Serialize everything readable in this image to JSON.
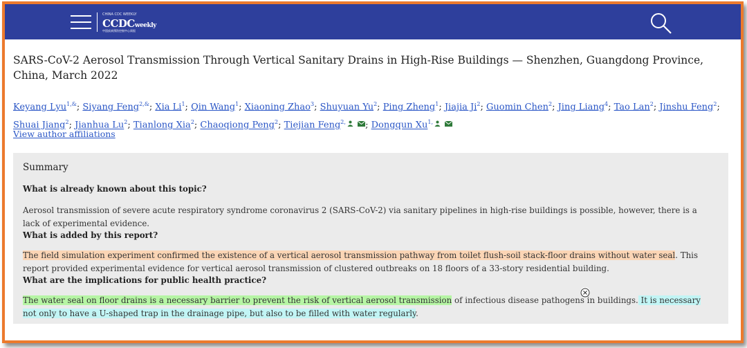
{
  "header": {
    "logo_top": "CHINA CDC WEEKLY",
    "logo_main": "CCDC",
    "logo_suffix": "weekly",
    "logo_sub": "中国疾病预防控制中心周报",
    "bg_color": "#2e3f9c"
  },
  "article": {
    "title": "SARS-CoV-2 Aerosol Transmission Through Vertical Sanitary Drains in High-Rise Buildings — Shenzhen, Guangdong Province, China, March 2022",
    "authors": [
      {
        "name": "Keyang Lyu",
        "sup": "1,&"
      },
      {
        "name": "Siyang Feng",
        "sup": "2,&"
      },
      {
        "name": "Xia Li",
        "sup": "1"
      },
      {
        "name": "Qin Wang",
        "sup": "1"
      },
      {
        "name": "Xiaoning Zhao",
        "sup": "3"
      },
      {
        "name": "Shuyuan Yu",
        "sup": "2"
      },
      {
        "name": "Ping Zheng",
        "sup": "1"
      },
      {
        "name": "Jiajia Ji",
        "sup": "2"
      },
      {
        "name": "Guomin Chen",
        "sup": "2"
      },
      {
        "name": "Jing Liang",
        "sup": "4"
      },
      {
        "name": "Tao Lan",
        "sup": "2"
      },
      {
        "name": "Jinshu Feng",
        "sup": "2"
      },
      {
        "name": "Shuai Jiang",
        "sup": "2"
      },
      {
        "name": "Jianhua Lu",
        "sup": "2"
      },
      {
        "name": "Tianlong Xia",
        "sup": "2"
      },
      {
        "name": "Chaoqiong Peng",
        "sup": "2"
      },
      {
        "name": "Tiejian Feng",
        "sup": "2,"
      },
      {
        "name": "Dongqun Xu",
        "sup": "1,"
      }
    ],
    "affiliations_link": "View author affiliations"
  },
  "summary": {
    "heading": "Summary",
    "q1": "What is already known about this topic?",
    "a1": "Aerosol transmission of severe acute respiratory syndrome coronavirus 2 (SARS-CoV-2) via sanitary pipelines in high-rise buildings is possible, however, there is a lack of experimental evidence.",
    "q2": "What is added by this report?",
    "a2_highlight": "The field simulation experiment confirmed the existence of a vertical aerosol transmission pathway from toilet flush-soil stack-floor drains without water seal",
    "a2_rest": ". This report provided experimental evidence for vertical aerosol transmission of clustered outbreaks on 18 floors of a 33-story residential building.",
    "q3": "What are the implications for public health practice?",
    "a3_highlight_green": "The water seal on floor drains is a necessary barrier to prevent the risk of vertical aerosol transmission",
    "a3_mid": " of infectious disease pathogens in buildings.",
    "a3_highlight_cyan": " It is necessary not only to have a U-shaped trap in the drainage pipe, but also to be filled with water regularly",
    "a3_end": "."
  },
  "colors": {
    "frame_border": "#ec7a2d",
    "link": "#2a56c6",
    "highlight_orange": "#fbd5b5",
    "highlight_green": "#b6f5a4",
    "highlight_cyan": "#c2f5f5",
    "summary_bg": "#ebebeb"
  }
}
